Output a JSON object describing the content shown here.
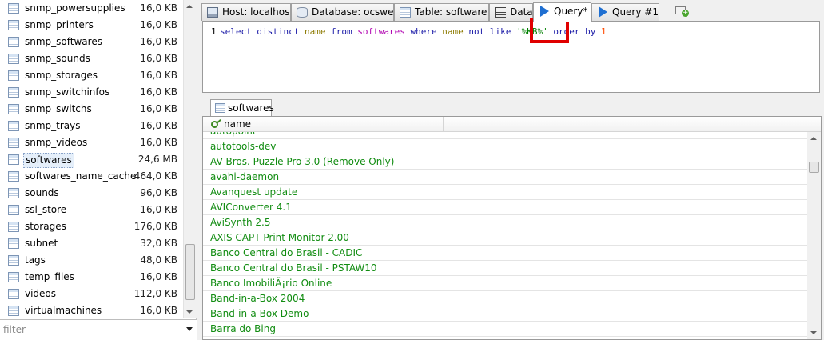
{
  "sidebar": {
    "tables": [
      {
        "name": "snmp_powersupplies",
        "size": "16,0 KB"
      },
      {
        "name": "snmp_printers",
        "size": "16,0 KB"
      },
      {
        "name": "snmp_softwares",
        "size": "16,0 KB"
      },
      {
        "name": "snmp_sounds",
        "size": "16,0 KB"
      },
      {
        "name": "snmp_storages",
        "size": "16,0 KB"
      },
      {
        "name": "snmp_switchinfos",
        "size": "16,0 KB"
      },
      {
        "name": "snmp_switchs",
        "size": "16,0 KB"
      },
      {
        "name": "snmp_trays",
        "size": "16,0 KB"
      },
      {
        "name": "snmp_videos",
        "size": "16,0 KB"
      },
      {
        "name": "softwares",
        "size": "24,6 MB"
      },
      {
        "name": "softwares_name_cache",
        "size": "464,0 KB"
      },
      {
        "name": "sounds",
        "size": "96,0 KB"
      },
      {
        "name": "ssl_store",
        "size": "16,0 KB"
      },
      {
        "name": "storages",
        "size": "176,0 KB"
      },
      {
        "name": "subnet",
        "size": "32,0 KB"
      },
      {
        "name": "tags",
        "size": "48,0 KB"
      },
      {
        "name": "temp_files",
        "size": "16,0 KB"
      },
      {
        "name": "videos",
        "size": "112,0 KB"
      },
      {
        "name": "virtualmachines",
        "size": "16,0 KB"
      }
    ],
    "selected_table": "softwares",
    "filter_placeholder": "filter"
  },
  "tabs": [
    {
      "label": "Host: localhost",
      "icon": "host-icon"
    },
    {
      "label": "Database: ocsweb",
      "icon": "database-icon"
    },
    {
      "label": "Table: softwares",
      "icon": "table-icon"
    },
    {
      "label": "Data",
      "icon": "data-grid-icon"
    },
    {
      "label": "Query*",
      "icon": "play-icon",
      "active": true
    },
    {
      "label": "Query #1",
      "icon": "play-icon"
    }
  ],
  "editor": {
    "line_number": "1",
    "tokens": {
      "select": "select",
      "distinct": "distinct",
      "name_col": "name",
      "from": "from",
      "table": "softwares",
      "where": "where",
      "name_col2": "name",
      "not": "not",
      "like": "like",
      "pattern": "'%KB%'",
      "order": "order",
      "by": "by",
      "order_num": "1"
    },
    "highlight_color": "#e00000"
  },
  "results": {
    "tab_label": "softwares",
    "column_header": "name",
    "rows": [
      "autopoint",
      "autotools-dev",
      "AV Bros. Puzzle Pro 3.0 (Remove Only)",
      "avahi-daemon",
      "Avanquest update",
      "AVIConverter 4.1",
      "AviSynth 2.5",
      "AXIS CAPT Print Monitor 2.00",
      "Banco Central do Brasil - CADIC",
      "Banco Central do Brasil - PSTAW10",
      "Banco ImobiliÃ¡rio Online",
      "Band-in-a-Box 2004",
      "Band-in-a-Box Demo",
      "Barra do Bing"
    ],
    "value_color": "#118c11"
  }
}
